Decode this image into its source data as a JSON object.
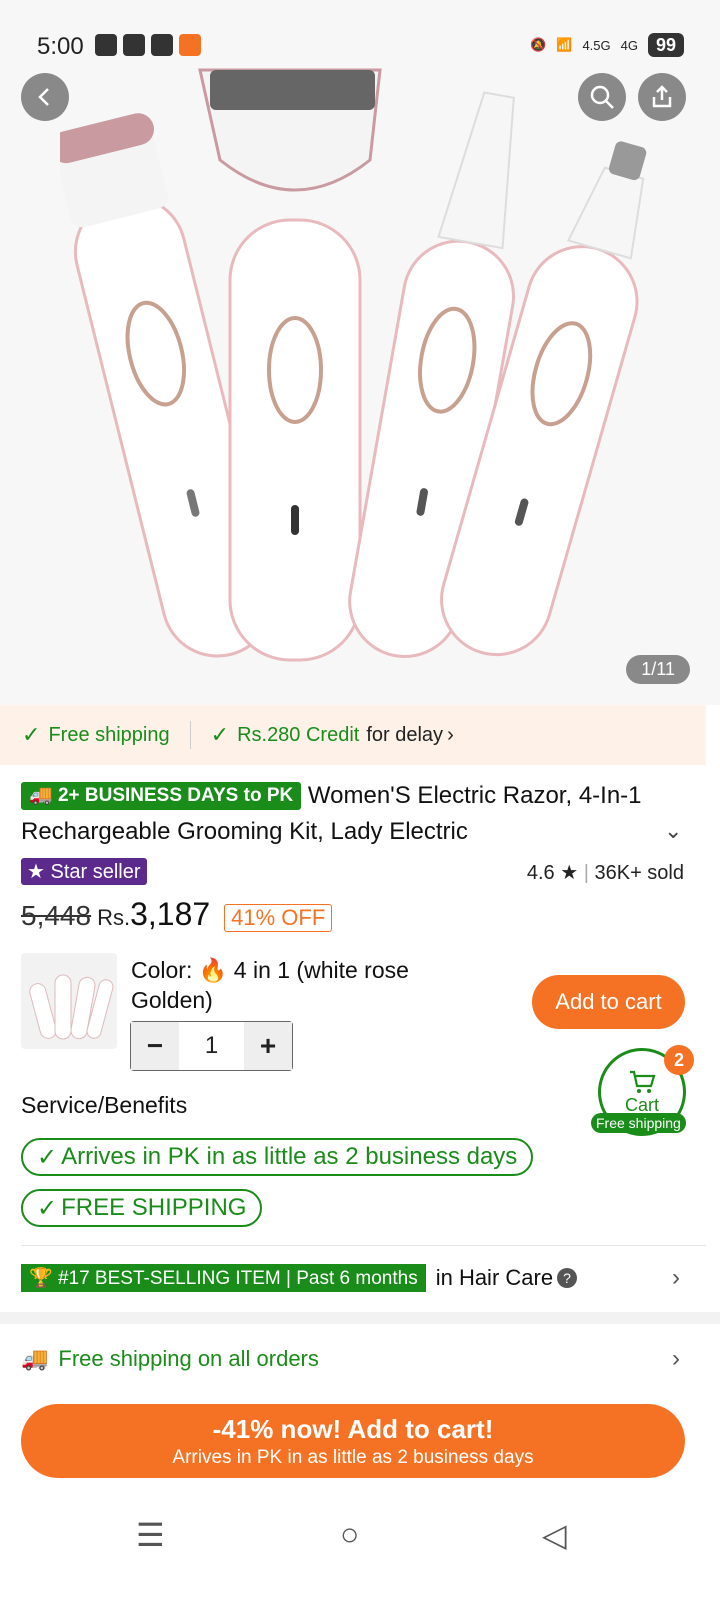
{
  "status_bar": {
    "time": "5:00",
    "network_1": "4.5G",
    "network_2": "4G",
    "battery": "99"
  },
  "gallery": {
    "counter": "1/11"
  },
  "shipping_strip": {
    "free_shipping": "Free shipping",
    "credit": "Rs.280 Credit",
    "credit_suffix": "for delay"
  },
  "product": {
    "days_badge": "2+ BUSINESS DAYS to PK",
    "title": "Women'S Electric Razor, 4-In-1 Rechargeable Grooming Kit, Lady Electric",
    "star_seller": "Star seller",
    "rating": "4.6",
    "sold": "36K+ sold",
    "old_price": "5,448",
    "price_label": "Rs.",
    "price": "3,187",
    "discount": "41% OFF",
    "color_label": "Color:",
    "color_value": "4 in 1 (white rose Golden)",
    "quantity": "1",
    "add_to_cart": "Add to cart"
  },
  "cart_float": {
    "label": "Cart",
    "count": "2",
    "free_shipping": "Free shipping"
  },
  "service": {
    "title": "Service/Benefits",
    "benefits": [
      "Arrives in PK in as little as 2 business days",
      "FREE SHIPPING"
    ]
  },
  "bestselling": {
    "badge": "#17 BEST-SELLING ITEM | Past 6 months",
    "category": "in Hair Care"
  },
  "free_shipping_row": {
    "label": "Free shipping on all orders"
  },
  "cta": {
    "main": "-41% now! Add to cart!",
    "sub": "Arrives in PK in as little as 2 business days"
  },
  "colors": {
    "accent": "#f57224",
    "green": "#1a8c1a",
    "star_seller": "#5b2a8c"
  }
}
